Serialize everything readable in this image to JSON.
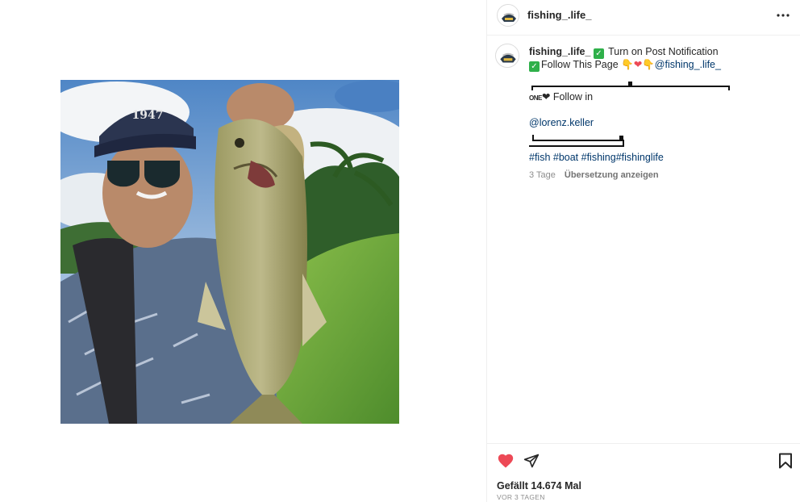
{
  "post": {
    "username": "fishing_.life_",
    "caption": {
      "line1_text": "Turn on Post Notification",
      "line2_text": "Follow This Page",
      "line2_mention": "@fishing_.life_",
      "follow_prefix": "ONE",
      "follow_text": "Follow in",
      "handle": "@lorenz.keller",
      "hashtags": "#fish #boat #fishing#fishinglife"
    },
    "age": "3 Tage",
    "translate_label": "Übersetzung anzeigen",
    "likes": "Gefällt 14.674 Mal",
    "timestamp": "VOR 3 TAGEN"
  },
  "icons": {
    "more": "more-horizontal-icon",
    "heart": "heart-filled-icon",
    "share": "send-icon",
    "save": "bookmark-icon"
  },
  "colors": {
    "heart": "#ed4956",
    "link": "#00376b",
    "secondary": "#8e8e8e",
    "check": "#2fb04a"
  }
}
